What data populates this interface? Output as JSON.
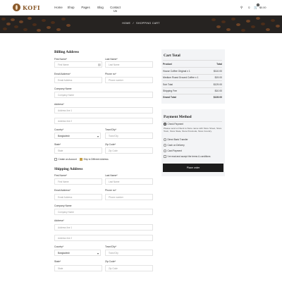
{
  "header": {
    "brand": "KOFI",
    "nav": [
      "Home",
      "Shop",
      "Pages",
      "Blog",
      "Contact Us"
    ],
    "cart_count": "0",
    "cart_total": "$0.00"
  },
  "hero": {
    "breadcrumb_home": "HOME",
    "breadcrumb_sep": "/",
    "breadcrumb_current": "SHOPPING CART"
  },
  "billing": {
    "title": "Billing Address",
    "first_name_label": "First Name*",
    "first_name_placeholder": "First Name",
    "last_name_label": "Last Name*",
    "last_name_placeholder": "Last Name",
    "email_label": "Email Address*",
    "email_placeholder": "Email Address",
    "phone_label": "Phone no*",
    "phone_placeholder": "Phone number",
    "company_label": "Company Name",
    "company_placeholder": "Company Name",
    "address_label": "Address*",
    "address1_placeholder": "Address line 1",
    "address2_placeholder": "Address line 2",
    "country_label": "Country*",
    "country_value": "Bangladesh",
    "town_label": "Town/City*",
    "town_placeholder": "Town/City",
    "state_label": "State*",
    "state_placeholder": "State",
    "zip_label": "Zip Code*",
    "zip_placeholder": "Zip Code",
    "create_account": "Create an Account",
    "ship_different": "Ship to Different Address"
  },
  "shipping": {
    "title": "Shipping Address",
    "first_name_label": "First Name*",
    "first_name_placeholder": "First Name",
    "last_name_label": "Last Name*",
    "last_name_placeholder": "Last Name",
    "email_label": "Email Address*",
    "email_placeholder": "Email Address",
    "phone_label": "Phone no*",
    "phone_placeholder": "Phone number",
    "company_label": "Company Name",
    "company_placeholder": "Company Name",
    "address_label": "Address*",
    "address1_placeholder": "Address line 1",
    "address2_placeholder": "Address line 2",
    "country_label": "Country*",
    "country_value": "Bangladesh",
    "town_label": "Town/City*",
    "town_placeholder": "Town/City",
    "state_label": "State*",
    "state_placeholder": "State",
    "zip_label": "Zip Code*",
    "zip_placeholder": "Zip Code"
  },
  "cart_total": {
    "title": "Cart Total",
    "col_product": "Product",
    "col_total": "Total",
    "items": [
      {
        "name": "House Coffee Original x 1",
        "total": "$110.00"
      },
      {
        "name": "Medium Roast Ground Coffee x 1",
        "total": "$19.00"
      }
    ],
    "subtotal_label": "Sub Total",
    "subtotal": "$129.00",
    "shipping_label": "Shipping Fee",
    "shipping": "$10.00",
    "grand_label": "Grand Total",
    "grand": "$139.00"
  },
  "payment": {
    "title": "Payment Method",
    "check_label": "Check Payment",
    "check_desc": "Please send a Check to Store name with Store Street, Store Town, Store State, Store Postcode, Store Country.",
    "bank": "Direct Bank Transfer",
    "cod": "Cash on Delivery",
    "card": "Card Payment",
    "terms": "I've read and accept the terms & conditions",
    "place_order": "Place order"
  }
}
